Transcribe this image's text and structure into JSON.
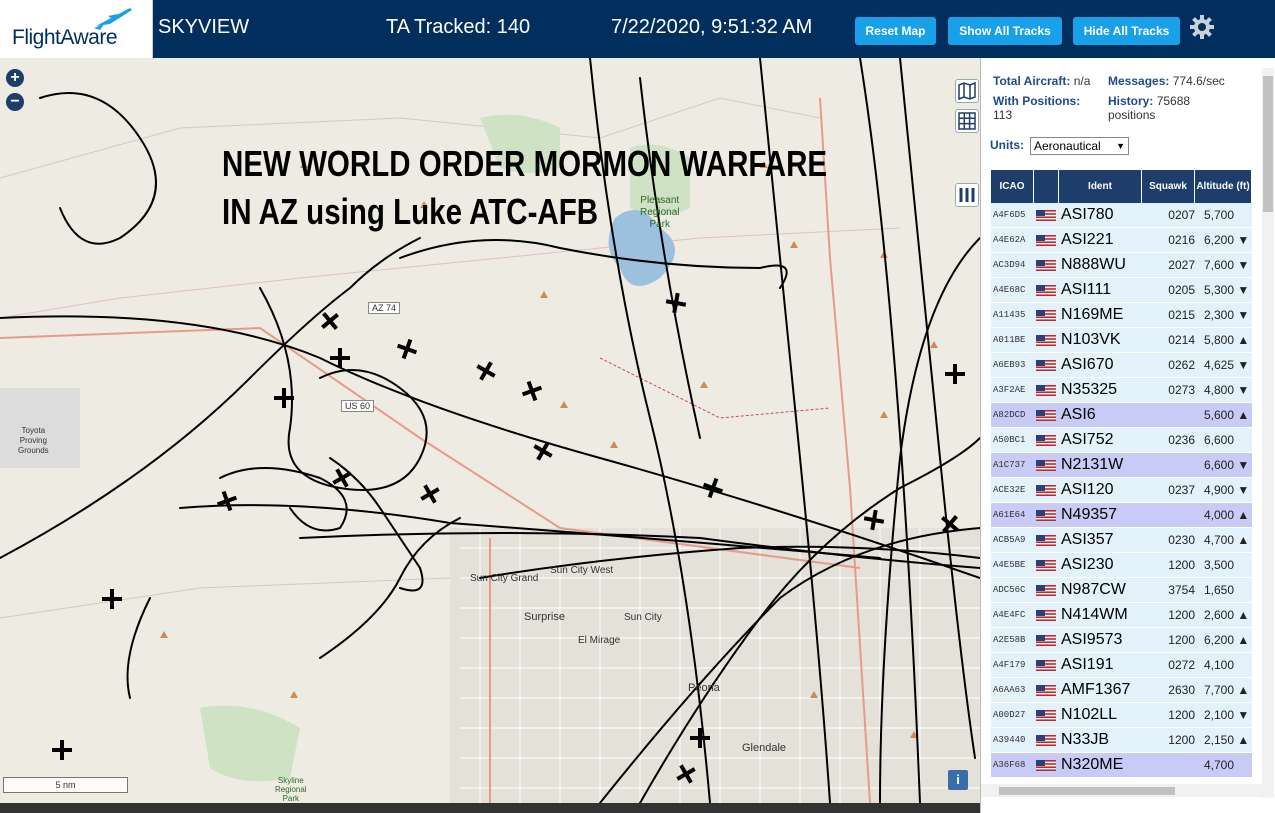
{
  "header": {
    "logo_text": "FlightAware",
    "app_name": "SKYVIEW",
    "tracked": "TA Tracked: 140",
    "datetime": "7/22/2020, 9:51:32 AM",
    "buttons": {
      "reset": "Reset Map",
      "show": "Show All Tracks",
      "hide": "Hide All Tracks"
    },
    "settings_icon": "gear-icon"
  },
  "map": {
    "overlay_title_line1": "NEW WORLD ORDER MORMON WARFARE",
    "overlay_title_line2": "IN AZ using Luke ATC-AFB",
    "zoom_in": "+",
    "zoom_out": "−",
    "scale": "5 nm",
    "info": "i",
    "labels": {
      "toyota": "Toyota\nProving\nGrounds",
      "az74": "AZ 74",
      "us60": "US 60",
      "pleasant": "Pleasant\nRegional\nPark",
      "sun_city_grand": "Sun City Grand",
      "sun_city_west": "Sun City West",
      "surprise": "Surprise",
      "sun_city": "Sun City",
      "el_mirage": "El Mirage",
      "peoria": "Peoria",
      "glendale": "Glendale",
      "skyline": "Skyline\nRegional\nPark"
    }
  },
  "panel": {
    "stats": {
      "total_label": "Total Aircraft:",
      "total_value": "n/a",
      "messages_label": "Messages:",
      "messages_value": "774.6/sec",
      "positions_label": "With Positions:",
      "positions_value": "113",
      "history_label": "History:",
      "history_value": "75688",
      "history_unit": "positions"
    },
    "units_label": "Units:",
    "units_value": "Aeronautical",
    "columns": [
      "ICAO",
      "",
      "Ident",
      "Squawk",
      "Altitude (ft)"
    ],
    "rows": [
      {
        "icao": "A4F6D5",
        "ident": "ASI780",
        "squawk": "0207",
        "alt": "5,700",
        "trend": "",
        "sel": false
      },
      {
        "icao": "A4E62A",
        "ident": "ASI221",
        "squawk": "0216",
        "alt": "6,200",
        "trend": "▼",
        "sel": false
      },
      {
        "icao": "AC3D94",
        "ident": "N888WU",
        "squawk": "2027",
        "alt": "7,600",
        "trend": "▼",
        "sel": false
      },
      {
        "icao": "A4E68C",
        "ident": "ASI111",
        "squawk": "0205",
        "alt": "5,300",
        "trend": "▼",
        "sel": false
      },
      {
        "icao": "A11435",
        "ident": "N169ME",
        "squawk": "0215",
        "alt": "2,300",
        "trend": "▼",
        "sel": false
      },
      {
        "icao": "A011BE",
        "ident": "N103VK",
        "squawk": "0214",
        "alt": "5,800",
        "trend": "▲",
        "sel": false
      },
      {
        "icao": "A6EB93",
        "ident": "ASI670",
        "squawk": "0262",
        "alt": "4,625",
        "trend": "▼",
        "sel": false
      },
      {
        "icao": "A3F2AE",
        "ident": "N35325",
        "squawk": "0273",
        "alt": "4,800",
        "trend": "▼",
        "sel": false
      },
      {
        "icao": "A82DCD",
        "ident": "ASI6",
        "squawk": "",
        "alt": "5,600",
        "trend": "▲",
        "sel": true
      },
      {
        "icao": "A50BC1",
        "ident": "ASI752",
        "squawk": "0236",
        "alt": "6,600",
        "trend": "",
        "sel": false
      },
      {
        "icao": "A1C737",
        "ident": "N2131W",
        "squawk": "",
        "alt": "6,600",
        "trend": "▼",
        "sel": true
      },
      {
        "icao": "ACE32E",
        "ident": "ASI120",
        "squawk": "0237",
        "alt": "4,900",
        "trend": "▼",
        "sel": false
      },
      {
        "icao": "A61E64",
        "ident": "N49357",
        "squawk": "",
        "alt": "4,000",
        "trend": "▲",
        "sel": true
      },
      {
        "icao": "ACB5A9",
        "ident": "ASI357",
        "squawk": "0230",
        "alt": "4,700",
        "trend": "▲",
        "sel": false
      },
      {
        "icao": "A4E5BE",
        "ident": "ASI230",
        "squawk": "1200",
        "alt": "3,500",
        "trend": "",
        "sel": false
      },
      {
        "icao": "ADC56C",
        "ident": "N987CW",
        "squawk": "3754",
        "alt": "1,650",
        "trend": "",
        "sel": false
      },
      {
        "icao": "A4E4FC",
        "ident": "N414WM",
        "squawk": "1200",
        "alt": "2,600",
        "trend": "▲",
        "sel": false
      },
      {
        "icao": "A2E58B",
        "ident": "ASI9573",
        "squawk": "1200",
        "alt": "6,200",
        "trend": "▲",
        "sel": false
      },
      {
        "icao": "A4F179",
        "ident": "ASI191",
        "squawk": "0272",
        "alt": "4,100",
        "trend": "",
        "sel": false
      },
      {
        "icao": "A6AA63",
        "ident": "AMF1367",
        "squawk": "2630",
        "alt": "7,700",
        "trend": "▲",
        "sel": false
      },
      {
        "icao": "A00D27",
        "ident": "N102LL",
        "squawk": "1200",
        "alt": "2,100",
        "trend": "▼",
        "sel": false
      },
      {
        "icao": "A39440",
        "ident": "N33JB",
        "squawk": "1200",
        "alt": "2,150",
        "trend": "▲",
        "sel": false
      },
      {
        "icao": "A36F68",
        "ident": "N320ME",
        "squawk": "",
        "alt": "4,700",
        "trend": "",
        "sel": true
      }
    ]
  }
}
